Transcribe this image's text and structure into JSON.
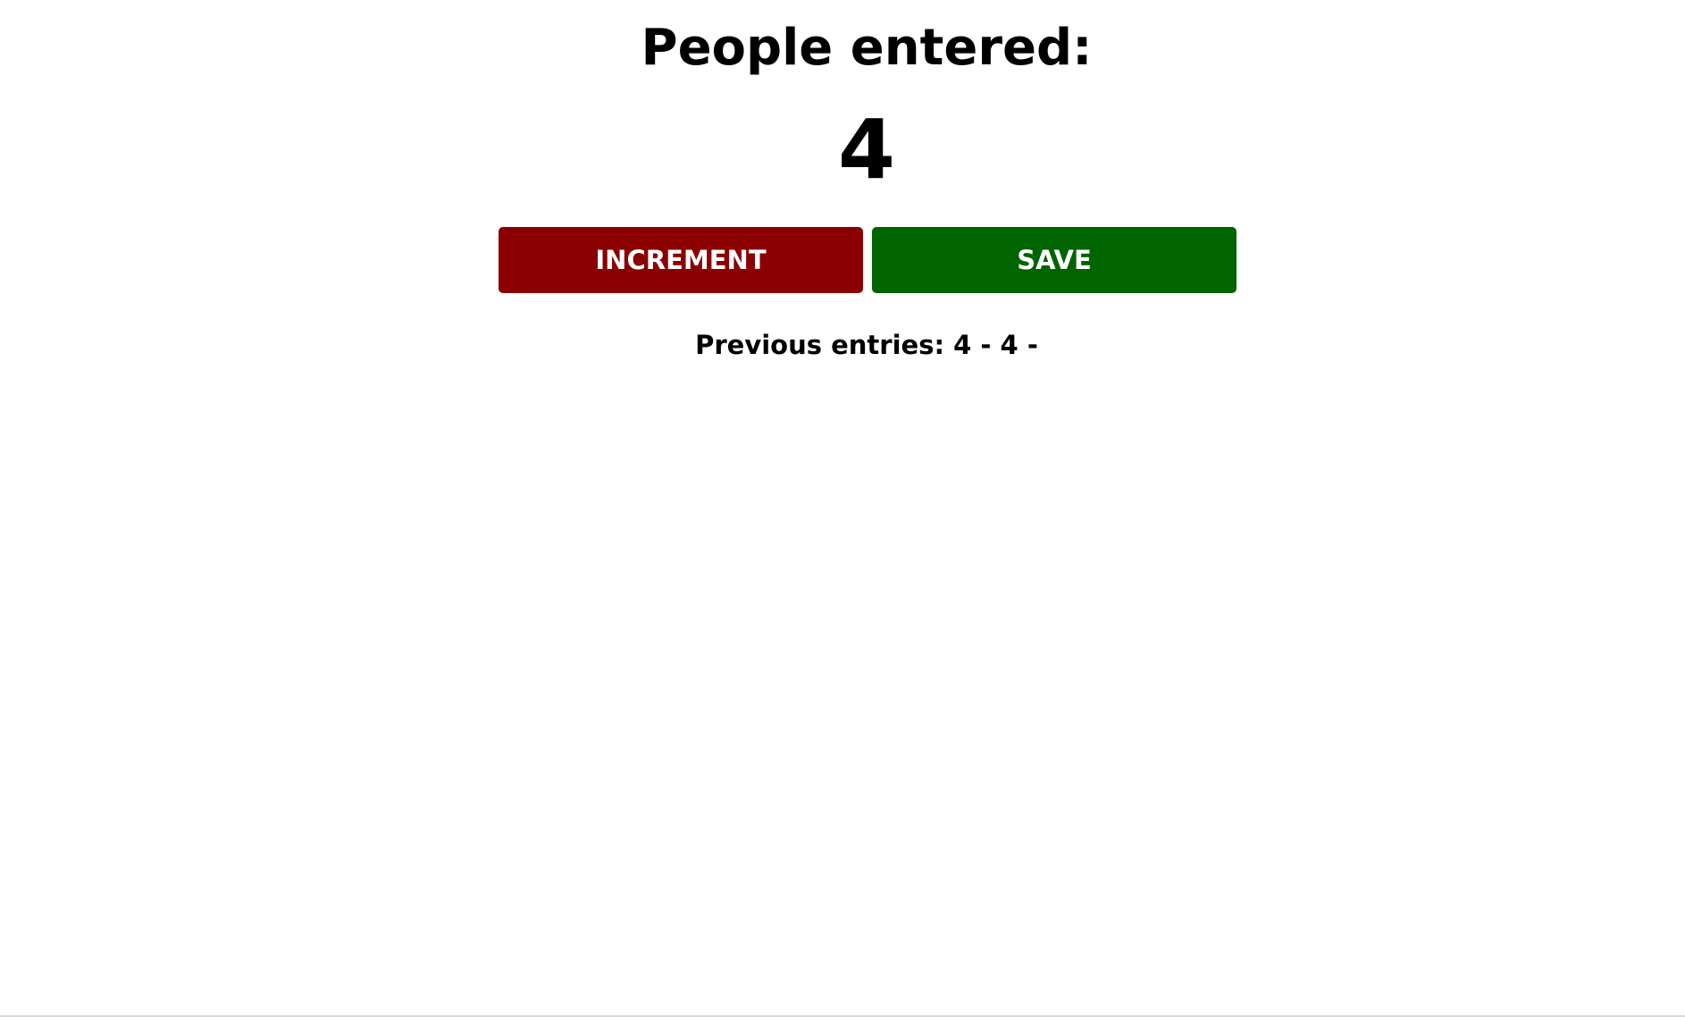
{
  "heading": "People entered:",
  "count": "4",
  "buttons": {
    "increment_label": "INCREMENT",
    "save_label": "SAVE"
  },
  "entries_text": "Previous entries: 4 - 4 -",
  "colors": {
    "increment_bg": "#8b0000",
    "save_bg": "#006400",
    "background": "#ffffff",
    "text": "#000000"
  }
}
